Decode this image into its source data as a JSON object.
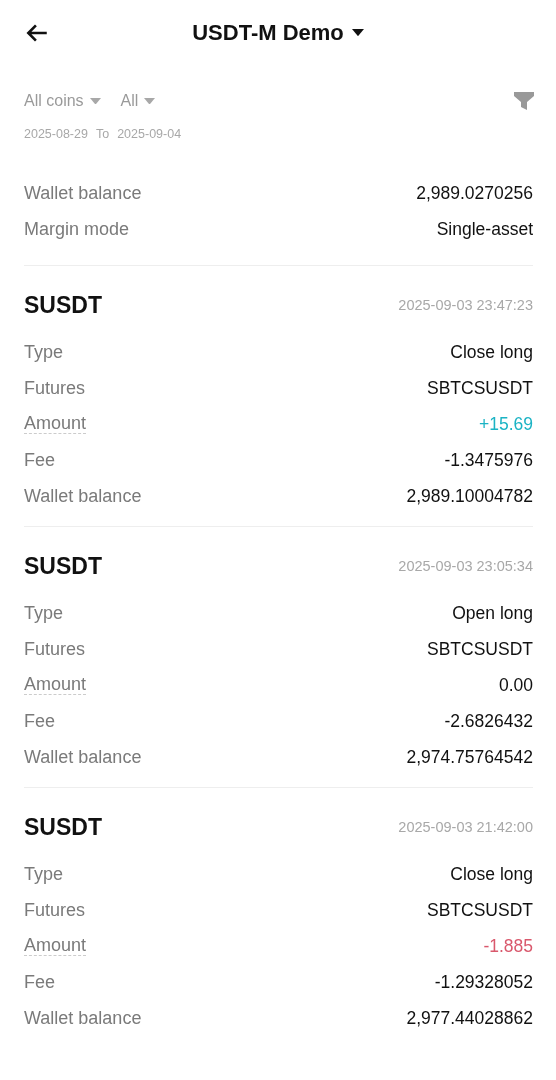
{
  "header": {
    "title": "USDT-M Demo"
  },
  "filters": [
    {
      "label": "All coins"
    },
    {
      "label": "All"
    }
  ],
  "date_range": {
    "from": "2025-08-29",
    "separator": "To",
    "to": "2025-09-04"
  },
  "partial_record": {
    "rows": [
      {
        "label": "Wallet balance",
        "value": "2,989.0270256",
        "dashed_underline": false,
        "color": "#111111"
      },
      {
        "label": "Margin mode",
        "value": "Single-asset",
        "dashed_underline": false,
        "color": "#111111"
      }
    ]
  },
  "records": [
    {
      "coin": "SUSDT",
      "time": "2025-09-03 23:47:23",
      "rows": [
        {
          "label": "Type",
          "value": "Close long",
          "dashed_underline": false,
          "color": "#111111"
        },
        {
          "label": "Futures",
          "value": "SBTCSUSDT",
          "dashed_underline": false,
          "color": "#111111"
        },
        {
          "label": "Amount",
          "value": "+15.69",
          "dashed_underline": true,
          "color": "#1bb3c4"
        },
        {
          "label": "Fee",
          "value": "-1.3475976",
          "dashed_underline": false,
          "color": "#111111"
        },
        {
          "label": "Wallet balance",
          "value": "2,989.10004782",
          "dashed_underline": false,
          "color": "#111111"
        }
      ]
    },
    {
      "coin": "SUSDT",
      "time": "2025-09-03 23:05:34",
      "rows": [
        {
          "label": "Type",
          "value": "Open long",
          "dashed_underline": false,
          "color": "#111111"
        },
        {
          "label": "Futures",
          "value": "SBTCSUSDT",
          "dashed_underline": false,
          "color": "#111111"
        },
        {
          "label": "Amount",
          "value": "0.00",
          "dashed_underline": true,
          "color": "#111111"
        },
        {
          "label": "Fee",
          "value": "-2.6826432",
          "dashed_underline": false,
          "color": "#111111"
        },
        {
          "label": "Wallet balance",
          "value": "2,974.75764542",
          "dashed_underline": false,
          "color": "#111111"
        }
      ]
    },
    {
      "coin": "SUSDT",
      "time": "2025-09-03 21:42:00",
      "rows": [
        {
          "label": "Type",
          "value": "Close long",
          "dashed_underline": false,
          "color": "#111111"
        },
        {
          "label": "Futures",
          "value": "SBTCSUSDT",
          "dashed_underline": false,
          "color": "#111111"
        },
        {
          "label": "Amount",
          "value": "-1.885",
          "dashed_underline": true,
          "color": "#d9586c"
        },
        {
          "label": "Fee",
          "value": "-1.29328052",
          "dashed_underline": false,
          "color": "#111111"
        },
        {
          "label": "Wallet balance",
          "value": "2,977.44028862",
          "dashed_underline": false,
          "color": "#111111"
        }
      ]
    }
  ]
}
